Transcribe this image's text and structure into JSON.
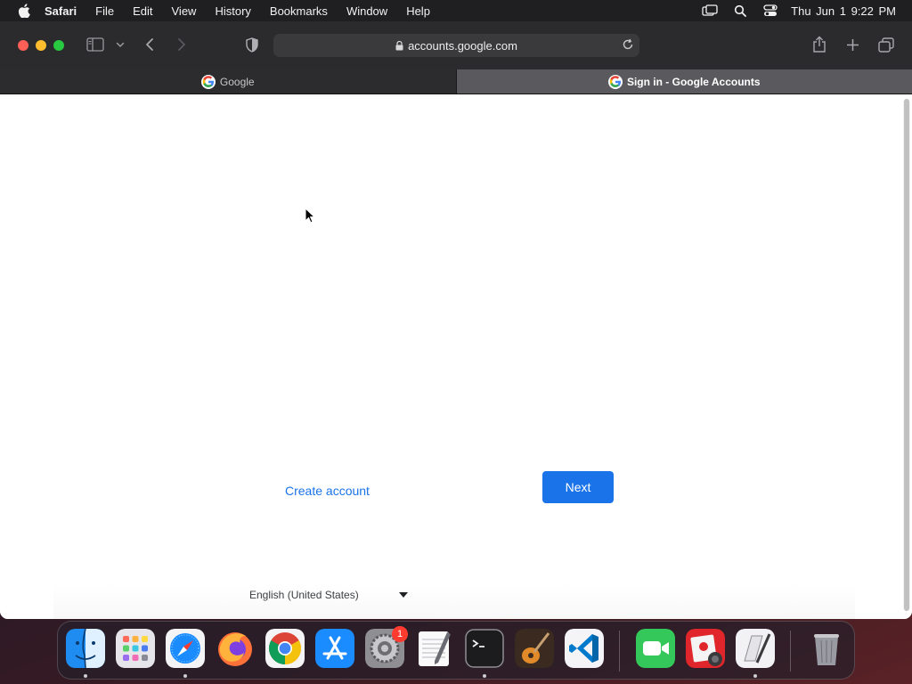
{
  "menubar": {
    "app_name": "Safari",
    "menus": [
      "File",
      "Edit",
      "View",
      "History",
      "Bookmarks",
      "Window",
      "Help"
    ],
    "clock": "Thu Jun 1  9:22 PM",
    "status_icons": [
      "screen-mirroring-icon",
      "spotlight-search-icon",
      "control-center-icon"
    ]
  },
  "toolbar": {
    "address": "accounts.google.com",
    "icons": [
      "sidebar-icon",
      "chevron-down-icon",
      "back-icon",
      "forward-icon",
      "privacy-shield-icon",
      "share-icon",
      "new-tab-icon",
      "tab-overview-icon"
    ]
  },
  "tabs": [
    {
      "label": "Google",
      "active": false
    },
    {
      "label": "Sign in - Google Accounts",
      "active": true
    }
  ],
  "page": {
    "create_account": "Create account",
    "next": "Next",
    "language": "English (United States)"
  },
  "dock": {
    "apps": [
      "Finder",
      "Launchpad",
      "Safari",
      "Firefox",
      "Google Chrome",
      "App Store",
      "System Settings",
      "TextEdit",
      "Terminal",
      "GarageBand",
      "Visual Studio Code",
      "FaceTime",
      "Photo Booth",
      "Script Editor",
      "Trash"
    ],
    "badge_count": "1"
  },
  "colors": {
    "accent": "#1a73e8",
    "close": "#fe5f57",
    "minimize": "#febc2e",
    "maximize": "#28c840"
  }
}
